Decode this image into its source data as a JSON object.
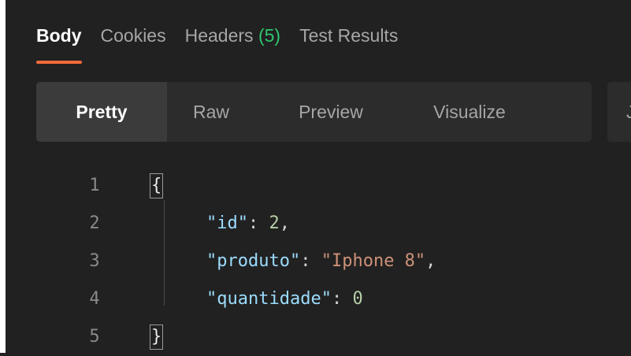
{
  "tabs": [
    {
      "label": "Body"
    },
    {
      "label": "Cookies"
    },
    {
      "label": "Headers",
      "count": "(5)"
    },
    {
      "label": "Test Results"
    }
  ],
  "view_modes": [
    {
      "label": "Pretty"
    },
    {
      "label": "Raw"
    },
    {
      "label": "Preview"
    },
    {
      "label": "Visualize"
    }
  ],
  "format_select": {
    "value": "J"
  },
  "editor": {
    "line_numbers": [
      "1",
      "2",
      "3",
      "4",
      "5"
    ],
    "open_brace": "{",
    "close_brace": "}",
    "lines": [
      {
        "key": "\"id\"",
        "colon": ": ",
        "value": "2",
        "comma": ","
      },
      {
        "key": "\"produto\"",
        "colon": ": ",
        "value": "\"Iphone 8\"",
        "comma": ","
      },
      {
        "key": "\"quantidade\"",
        "colon": ": ",
        "value": "0",
        "comma": ""
      }
    ]
  },
  "colors": {
    "background": "#212121",
    "active_tab_underline": "#f26b3a",
    "headers_count": "#2ec66d",
    "json_key": "#9cdcfe",
    "json_string": "#ce9178",
    "json_number": "#b5cea8"
  }
}
